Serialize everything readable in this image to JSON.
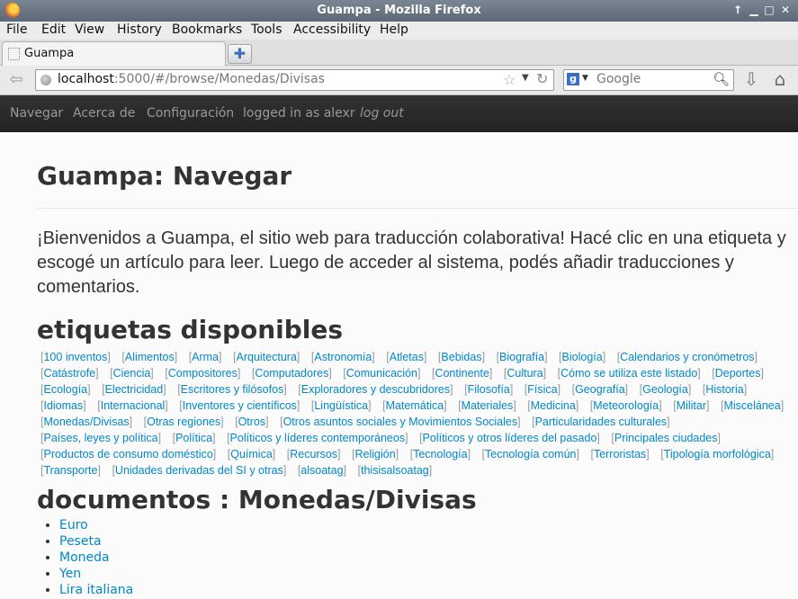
{
  "window": {
    "title": "Guampa - Mozilla Firefox"
  },
  "menubar": [
    "File",
    "Edit",
    "View",
    "History",
    "Bookmarks",
    "Tools",
    "Accessibility",
    "Help"
  ],
  "tab": {
    "label": "Guampa"
  },
  "urlbar": {
    "host": "localhost",
    "rest": ":5000/#/browse/Monedas/Divisas"
  },
  "search": {
    "placeholder": "Google"
  },
  "sitenav": {
    "navegar": "Navegar",
    "acerca": "Acerca de",
    "config": "Configuración",
    "logged": "logged in as alexr",
    "logout": "log out"
  },
  "page": {
    "title": "Guampa: Navegar",
    "lead": "¡Bienvenidos a Guampa, el sitio web para traducción colaborativa! Hacé clic en una etiqueta y escogé un artículo para leer. Luego de acceder al sistema, podés añadir traducciones y comentarios.",
    "tags_heading": "etiquetas disponibles",
    "docs_heading": "documentos : Monedas/Divisas"
  },
  "tags": [
    "100 inventos",
    "Alimentos",
    "Arma",
    "Arquitectura",
    "Astronomía",
    "Atletas",
    "Bebidas",
    "Biografía",
    "Biología",
    "Calendarios y cronómetros",
    "Catástrofe",
    "Ciencia",
    "Compositores",
    "Computadores",
    "Comunicación",
    "Continente",
    "Cultura",
    "Cómo se utiliza este listado",
    "Deportes",
    "Ecología",
    "Electricidad",
    "Escritores y filósofos",
    "Exploradores y descubridores",
    "Filosofía",
    "Física",
    "Geografía",
    "Geología",
    "Historia",
    "Idiomas",
    "Internacional",
    "Inventores y científicos",
    "Lingüística",
    "Matemática",
    "Materiales",
    "Medicina",
    "Meteorología",
    "Militar",
    "Miscelánea",
    "Monedas/Divisas",
    "Otras regiones",
    "Otros",
    "Otros asuntos sociales y Movimientos Sociales",
    "Particularidades culturales",
    "Países, leyes y política",
    "Política",
    "Políticos y líderes contemporáneos",
    "Políticos y otros líderes del pasado",
    "Principales ciudades",
    "Productos de consumo doméstico",
    "Química",
    "Recursos",
    "Religión",
    "Tecnología",
    "Tecnología común",
    "Terroristas",
    "Tipología morfológica",
    "Transporte",
    "Unidades derivadas del SI y otras",
    "alsoatag",
    "thisisalsoatag"
  ],
  "documents": [
    "Euro",
    "Peseta",
    "Moneda",
    "Yen",
    "Lira italiana"
  ]
}
